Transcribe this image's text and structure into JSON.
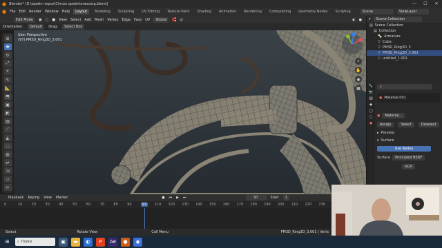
{
  "titlebar": {
    "title": "Blender* [D:\\арейн перси\\Chross арейн\\инвалид.blend]"
  },
  "menubar": {
    "items": [
      "File",
      "Edit",
      "Render",
      "Window",
      "Help"
    ],
    "workspaces": [
      "Layout",
      "Modeling",
      "Sculpting",
      "UV Editing",
      "Texture Paint",
      "Shading",
      "Animation",
      "Rendering",
      "Compositing",
      "Geometry Nodes",
      "Scripting"
    ],
    "scene_label": "Scene",
    "view_layer_label": "ViewLayer"
  },
  "header3d": {
    "mode": "Edit Mode",
    "menus": [
      "View",
      "Select",
      "Add",
      "Mesh",
      "Vertex",
      "Edge",
      "Face",
      "UV"
    ],
    "transform": "Global"
  },
  "tooloptions": {
    "orientation_label": "Orientation:",
    "orientation_value": "Default",
    "drag_label": "Drag:",
    "drag_value": "Select Box"
  },
  "viewport": {
    "view_name": "User Perspective",
    "object_info": "(97) PM3D_Ring3D_3.001"
  },
  "outliner": {
    "search_placeholder": "Scene Collection",
    "rows": [
      "Scene Collection",
      "Collection",
      "Armature",
      "Cube",
      "PM3D_Ring3D_3",
      "PM3D_Ring3D_3.001",
      "untitled_1.001"
    ],
    "selected_index": 5
  },
  "properties": {
    "material_slot": "Material.001",
    "material_name": "Material...",
    "assign": "Assign",
    "select": "Select",
    "deselect": "Deselect",
    "preview": "Preview",
    "surface": "Surface",
    "use_nodes": "Use Nodes",
    "surface_label": "Surface",
    "shader": "Principled BSDF",
    "ggx": "GGX"
  },
  "timeline": {
    "menus": [
      "Playback",
      "Keying",
      "View",
      "Marker"
    ],
    "current_frame": "97",
    "start_label": "Start",
    "start_value": "1",
    "ruler": [
      "0",
      "10",
      "20",
      "30",
      "40",
      "50",
      "60",
      "70",
      "80",
      "90",
      "97",
      "110",
      "120",
      "130",
      "140",
      "150",
      "160",
      "170",
      "180",
      "190",
      "200",
      "210",
      "220",
      "230"
    ]
  },
  "statusbar": {
    "left": "Select",
    "middle": "Rotate View",
    "right": "Call Menu",
    "info": "PM3D_Ring3D_3.001 | Verts"
  },
  "taskbar": {
    "search_label": "Поиск"
  },
  "colors": {
    "accent": "#4772b3",
    "selected_row": "#334d80",
    "frame_marker": "#4772b3",
    "keyframe_cursor": "#5ea05e"
  },
  "icons": [
    "blender-logo-icon",
    "minimize-icon",
    "maximize-icon",
    "close-icon",
    "cursor-icon",
    "move-icon",
    "rotate-icon",
    "scale-icon",
    "transform-icon",
    "annotate-icon",
    "measure-icon",
    "extrude-icon",
    "inset-icon",
    "bevel-icon",
    "loopcut-icon",
    "knife-icon",
    "polybuild-icon",
    "spin-icon",
    "smooth-icon",
    "edge-slide-icon",
    "shrink-icon",
    "shear-icon",
    "rip-icon",
    "zoom-icon",
    "hand-icon",
    "camera-icon",
    "grid-icon",
    "windows-start-icon",
    "search-icon"
  ]
}
